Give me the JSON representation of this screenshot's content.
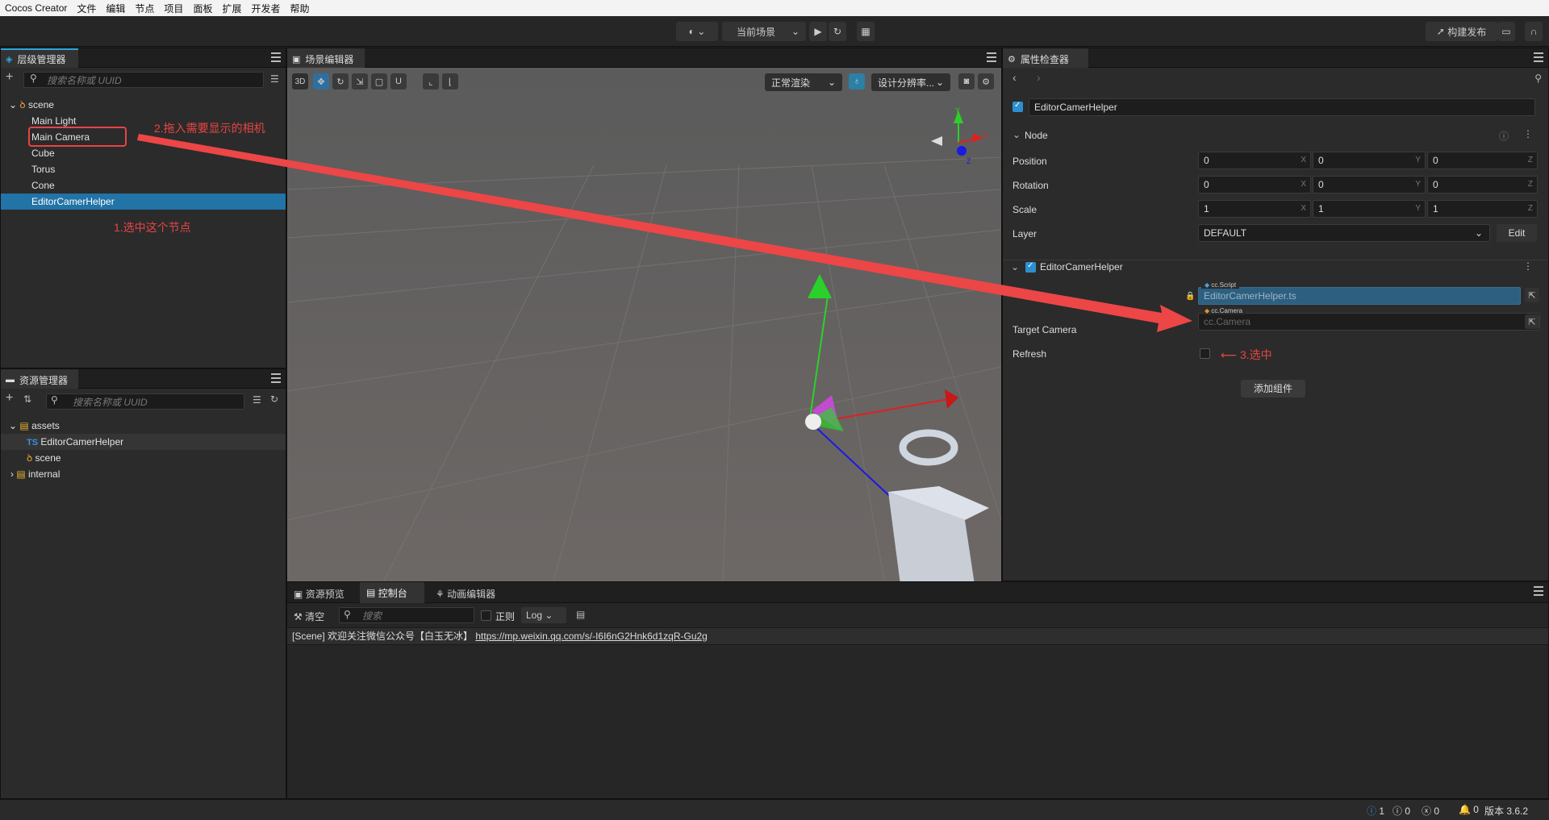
{
  "menubar": {
    "app": "Cocos Creator",
    "items": [
      "文件",
      "编辑",
      "节点",
      "项目",
      "面板",
      "扩展",
      "开发者",
      "帮助"
    ]
  },
  "toolbar": {
    "scene_select": "当前场景",
    "build_label": "构建发布"
  },
  "hierarchy": {
    "title": "层级管理器",
    "search_placeholder": "搜索名称或 UUID",
    "root": "scene",
    "children": [
      "Main Light",
      "Main Camera",
      "Cube",
      "Torus",
      "Cone",
      "EditorCamerHelper"
    ],
    "annotation_select": "1.选中这个节点",
    "annotation_drag": "2.拖入需要显示的相机"
  },
  "assets": {
    "title": "资源管理器",
    "search_placeholder": "搜索名称或 UUID",
    "root": "assets",
    "ts_badge": "TS",
    "children": [
      "EditorCamerHelper",
      "scene"
    ],
    "internal": "internal"
  },
  "scene_editor": {
    "title": "场景编辑器",
    "mode_3d": "3D",
    "render_mode": "正常渲染",
    "resolution": "设计分辨率..."
  },
  "inspector": {
    "title": "属性检查器",
    "node_name": "EditorCamerHelper",
    "section_node": "Node",
    "position": {
      "label": "Position",
      "x": "0",
      "y": "0",
      "z": "0"
    },
    "rotation": {
      "label": "Rotation",
      "x": "0",
      "y": "0",
      "z": "0"
    },
    "scale": {
      "label": "Scale",
      "x": "1",
      "y": "1",
      "z": "1"
    },
    "axes": [
      "X",
      "Y",
      "Z"
    ],
    "layer": {
      "label": "Layer",
      "value": "DEFAULT",
      "edit": "Edit"
    },
    "component": "EditorCamerHelper",
    "script_tag": "cc.Script",
    "script_value": "EditorCamerHelper.ts",
    "camera_tag": "cc.Camera",
    "target_camera": {
      "label": "Target Camera",
      "placeholder": "cc.Camera"
    },
    "refresh": {
      "label": "Refresh"
    },
    "annotation_refresh": "3.选中",
    "add_component": "添加组件"
  },
  "bottom": {
    "tabs": [
      "资源预览",
      "控制台",
      "动画编辑器"
    ],
    "clear": "清空",
    "search_placeholder": "搜索",
    "regex": "正则",
    "level": "Log",
    "log_prefix": "[Scene] 欢迎关注微信公众号【白玉无冰】",
    "log_link": "https://mp.weixin.qq.com/s/-I6I6nG2Hnk6d1zqR-Gu2g"
  },
  "status": {
    "info": "1",
    "warn": "0",
    "error": "0",
    "notify": "0",
    "version": "版本 3.6.2"
  },
  "colors": {
    "accent": "#2ea6d9",
    "selection": "#2273a6",
    "annotation": "#e84444"
  }
}
